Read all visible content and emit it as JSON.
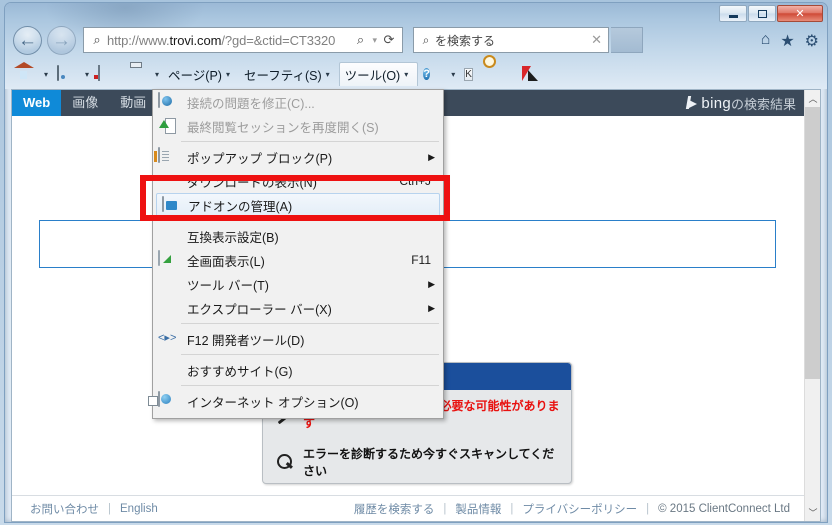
{
  "window": {
    "minimize_label": "Minimize",
    "maximize_label": "Maximize",
    "close_label": "✕"
  },
  "nav": {
    "back_label": "←",
    "forward_label": "→",
    "address": {
      "icon": "search-icon",
      "prefix": "http://www.",
      "host": "trovi.com",
      "suffix": "/?gd=&ctid=CT3320",
      "search_glyph": "⌕",
      "caret_glyph": "▾",
      "refresh_glyph": "⟳"
    },
    "search": {
      "icon_glyph": "⌕",
      "placeholder": "を検索する",
      "clear_glyph": "✕"
    },
    "right_icons": [
      {
        "name": "home-icon",
        "glyph": "⌂"
      },
      {
        "name": "favorites-icon",
        "glyph": "★"
      },
      {
        "name": "settings-gear-icon",
        "glyph": "⚙"
      }
    ]
  },
  "commandbar": {
    "items": [
      {
        "name": "home-button",
        "icon": "home-icon",
        "label": "",
        "caret": "▾"
      },
      {
        "name": "feeds-button",
        "icon": "feed-icon",
        "label": "",
        "caret": "▾"
      },
      {
        "name": "read-mail-button",
        "icon": "mail-icon",
        "label": "",
        "caret": ""
      },
      {
        "name": "print-button",
        "icon": "print-icon",
        "label": "",
        "caret": "▾"
      },
      {
        "name": "page-menu",
        "icon": "",
        "label": "ページ(P)",
        "caret": "▾"
      },
      {
        "name": "safety-menu",
        "icon": "",
        "label": "セーフティ(S)",
        "caret": "▾"
      },
      {
        "name": "tools-menu",
        "icon": "",
        "label": "ツール(O)",
        "caret": "▾"
      },
      {
        "name": "help-button",
        "icon": "help-icon",
        "label": "",
        "caret": "▾"
      },
      {
        "name": "k-addon-button",
        "icon": "k-icon",
        "label": "",
        "caret": ""
      },
      {
        "name": "document-scan-button",
        "icon": "document-magnifier-icon",
        "label": "",
        "caret": ""
      },
      {
        "name": "kaspersky-button",
        "icon": "kaspersky-icon",
        "label": "",
        "caret": ""
      }
    ]
  },
  "tools_menu": {
    "items": [
      {
        "name": "fix-connection-problems",
        "label": "接続の問題を修正(C)...",
        "icon": "globe-repair-icon",
        "accel": "",
        "arrow": "",
        "disabled": true,
        "highlighted": false
      },
      {
        "name": "reopen-last-session",
        "label": "最終閲覧セッションを再度開く(S)",
        "icon": "reopen-session-icon",
        "accel": "",
        "arrow": "",
        "disabled": true,
        "highlighted": false
      },
      {
        "name": "separator-1",
        "label": "",
        "icon": "",
        "accel": "",
        "arrow": "",
        "separator": true
      },
      {
        "name": "popup-blocker",
        "label": "ポップアップ ブロック(P)",
        "icon": "popup-blocker-icon",
        "accel": "",
        "arrow": "▶",
        "disabled": false,
        "highlighted": false
      },
      {
        "name": "view-downloads",
        "label": "ダウンロードの表示(N)",
        "icon": "",
        "accel": "Ctrl+J",
        "arrow": "",
        "disabled": false,
        "highlighted": false
      },
      {
        "name": "manage-addons",
        "label": "アドオンの管理(A)",
        "icon": "manage-addons-icon",
        "accel": "",
        "arrow": "",
        "disabled": false,
        "highlighted": true
      },
      {
        "name": "separator-2",
        "label": "",
        "icon": "",
        "accel": "",
        "arrow": "",
        "separator": true
      },
      {
        "name": "compatibility-view-settings",
        "label": "互換表示設定(B)",
        "icon": "",
        "accel": "",
        "arrow": "",
        "disabled": false,
        "highlighted": false
      },
      {
        "name": "full-screen",
        "label": "全画面表示(L)",
        "icon": "fullscreen-icon",
        "accel": "F11",
        "arrow": "",
        "disabled": false,
        "highlighted": false
      },
      {
        "name": "toolbars",
        "label": "ツール バー(T)",
        "icon": "",
        "accel": "",
        "arrow": "▶",
        "disabled": false,
        "highlighted": false
      },
      {
        "name": "explorer-bars",
        "label": "エクスプローラー バー(X)",
        "icon": "",
        "accel": "",
        "arrow": "▶",
        "disabled": false,
        "highlighted": false
      },
      {
        "name": "separator-3",
        "label": "",
        "icon": "",
        "accel": "",
        "arrow": "",
        "separator": true
      },
      {
        "name": "f12-developer-tools",
        "label": "F12 開発者ツール(D)",
        "icon": "developer-tools-icon",
        "accel": "",
        "arrow": "",
        "disabled": false,
        "highlighted": false
      },
      {
        "name": "separator-4",
        "label": "",
        "icon": "",
        "accel": "",
        "arrow": "",
        "separator": true
      },
      {
        "name": "suggested-sites",
        "label": "おすすめサイト(G)",
        "icon": "",
        "accel": "",
        "arrow": "",
        "disabled": false,
        "highlighted": false
      },
      {
        "name": "separator-5",
        "label": "",
        "icon": "",
        "accel": "",
        "arrow": "",
        "separator": true
      },
      {
        "name": "internet-options",
        "label": "インターネット オプション(O)",
        "icon": "internet-options-icon",
        "accel": "",
        "arrow": "",
        "disabled": false,
        "highlighted": false
      }
    ]
  },
  "page": {
    "nav_tabs": [
      {
        "name": "tab-web",
        "label": "Web",
        "selected": true
      },
      {
        "name": "tab-images",
        "label": "画像",
        "selected": false
      },
      {
        "name": "tab-videos",
        "label": "動画",
        "selected": false
      }
    ],
    "provider": {
      "logo_text": "bing",
      "suffix": "の検索結果"
    },
    "search_input_value": "",
    "ad_panel": {
      "lines": [
        {
          "name": "ad-warning-line",
          "icon": "wrench-icon",
          "text": "Windowsエラーの修正が必要な可能性があります",
          "style": "warn"
        },
        {
          "name": "ad-scan-line",
          "icon": "magnifier-icon",
          "text": "エラーを診断するため今すぐスキャンしてください",
          "style": "scan"
        }
      ]
    },
    "footer": {
      "left": [
        {
          "name": "footer-contact",
          "label": "お問い合わせ"
        },
        {
          "name": "footer-pipe-1",
          "label": "|"
        },
        {
          "name": "footer-english",
          "label": "English"
        }
      ],
      "right": [
        {
          "name": "footer-search-history",
          "label": "履歴を検索する"
        },
        {
          "name": "footer-pipe-2",
          "label": "|"
        },
        {
          "name": "footer-product-info",
          "label": "製品情報"
        },
        {
          "name": "footer-pipe-3",
          "label": "|"
        },
        {
          "name": "footer-privacy-policy",
          "label": "プライバシーポリシー"
        },
        {
          "name": "footer-pipe-4",
          "label": "|"
        },
        {
          "name": "footer-copyright",
          "label": "© 2015 ClientConnect Ltd"
        }
      ]
    },
    "scrollbar": {
      "up_glyph": "︿",
      "down_glyph": "﹀"
    }
  },
  "annotation": {
    "color": "#ee1111"
  }
}
